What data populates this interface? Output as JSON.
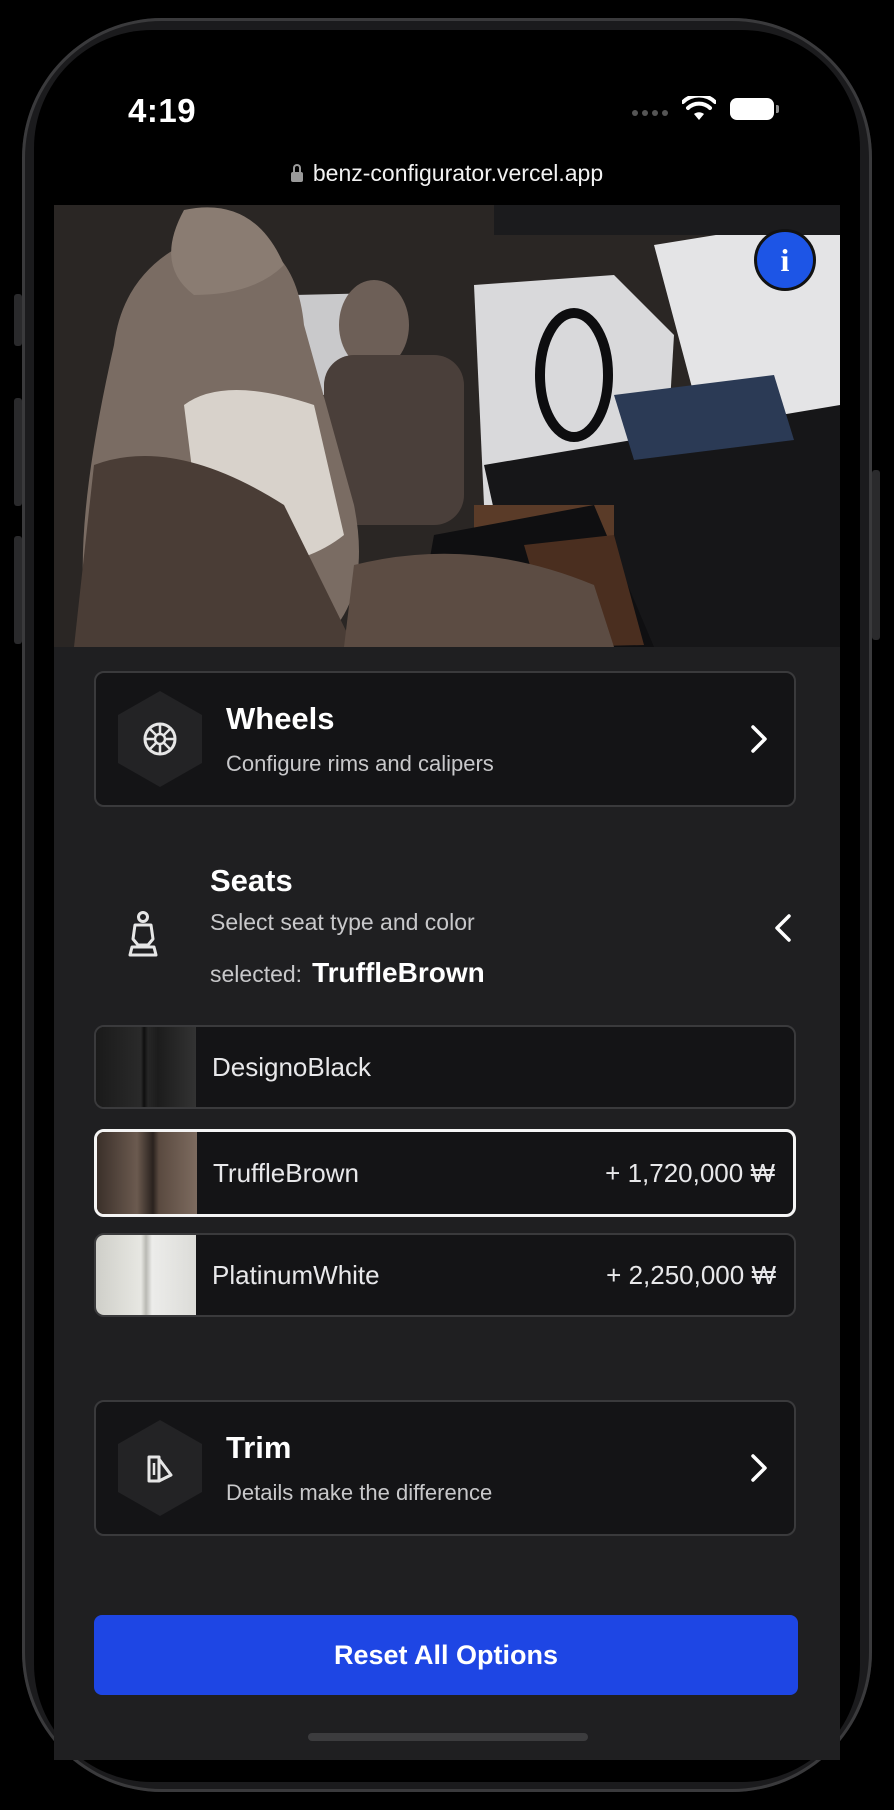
{
  "status": {
    "time": "4:19"
  },
  "browser": {
    "url": "benz-configurator.vercel.app"
  },
  "hero": {
    "info_label": "i"
  },
  "wheels": {
    "title": "Wheels",
    "subtitle": "Configure rims and calipers"
  },
  "seats": {
    "title": "Seats",
    "subtitle": "Select seat type and color",
    "selected_prefix": "selected:",
    "selected_value": "TruffleBrown",
    "options": [
      {
        "name": "DesignoBlack",
        "price": ""
      },
      {
        "name": "TruffleBrown",
        "price": "+ 1,720,000 ₩",
        "selected": true
      },
      {
        "name": "PlatinumWhite",
        "price": "+ 2,250,000 ₩"
      }
    ]
  },
  "trim": {
    "title": "Trim",
    "subtitle": "Details make the difference"
  },
  "reset_label": "Reset All Options",
  "colors": {
    "accent": "#1e46e4",
    "info": "#1d55e6",
    "card": "#141416",
    "panel": "#1f1f21"
  },
  "icons": {
    "wheels": "wheel-icon",
    "seats": "seat-icon",
    "trim": "trim-icon",
    "info": "info-icon",
    "expand": "chevron-right-icon",
    "collapse": "chevron-left-icon"
  }
}
